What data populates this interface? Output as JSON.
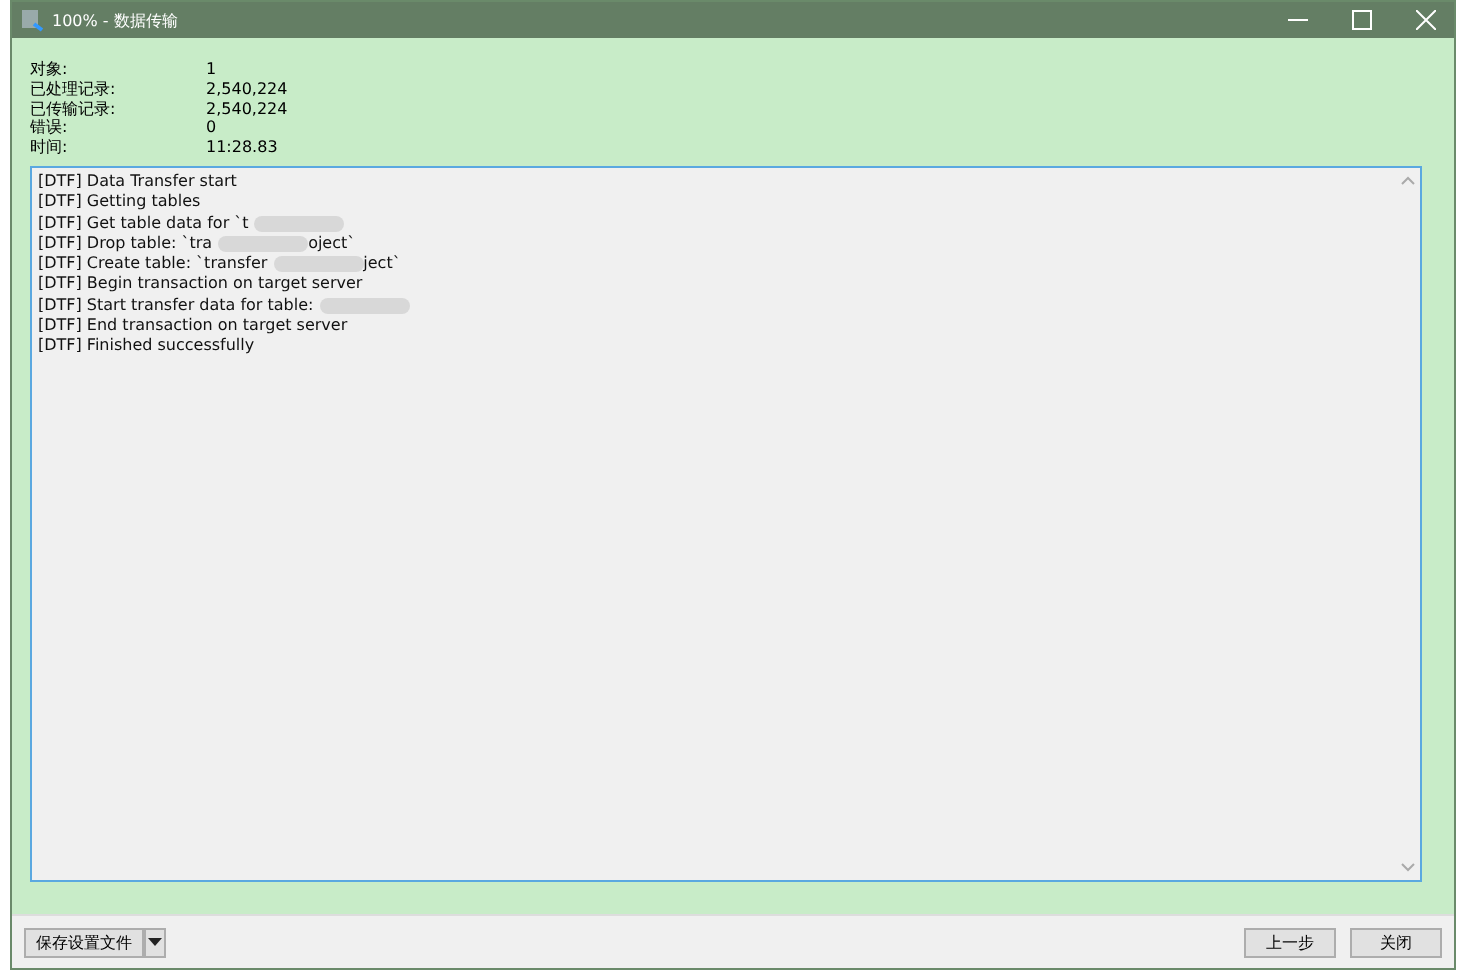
{
  "window": {
    "title": "100% - 数据传输"
  },
  "stats": [
    {
      "label": "对象:",
      "value": "1"
    },
    {
      "label": "已处理记录:",
      "value": "2,540,224"
    },
    {
      "label": "已传输记录:",
      "value": "2,540,224"
    },
    {
      "label": "错误:",
      "value": "0"
    },
    {
      "label": "时间:",
      "value": "11:28.83"
    }
  ],
  "log": [
    {
      "text": "[DTF] Data Transfer start",
      "redacted": false
    },
    {
      "text": "[DTF] Getting tables",
      "redacted": false
    },
    {
      "text": "[DTF] Get table data for `t",
      "redacted": true
    },
    {
      "text": "[DTF] Drop table: `tra",
      "redacted": true,
      "after": "oject`"
    },
    {
      "text": "[DTF] Create table: `transfer",
      "redacted": true,
      "after": "ject`"
    },
    {
      "text": "[DTF] Begin transaction on target server",
      "redacted": false
    },
    {
      "text": "[DTF] Start transfer data for table:",
      "redacted": true
    },
    {
      "text": "[DTF] End transaction on target server",
      "redacted": false
    },
    {
      "text": "[DTF] Finished successfully",
      "redacted": false
    }
  ],
  "footer": {
    "save_button": "保存设置文件",
    "buttons": [
      "上一步",
      "关闭"
    ]
  }
}
